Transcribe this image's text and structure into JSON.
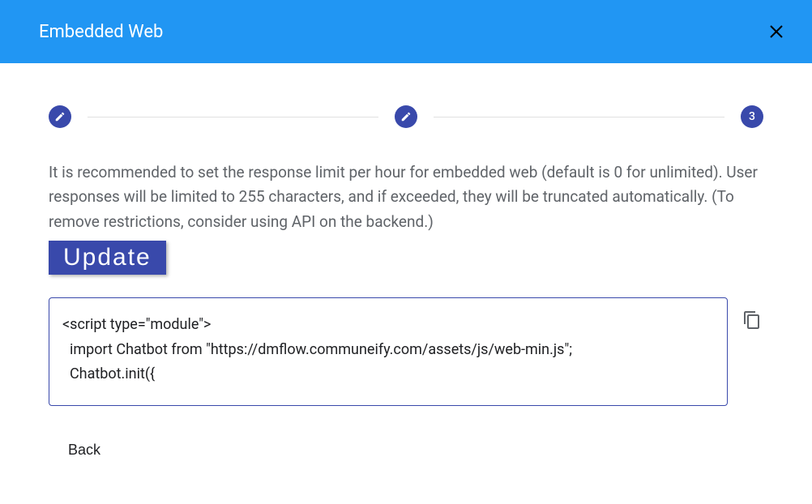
{
  "header": {
    "title": "Embedded Web"
  },
  "stepper": {
    "current_step": "3"
  },
  "description": "It is recommended to set the response limit per hour for embedded web (default is 0 for unlimited). User responses will be limited to 255 characters, and if exceeded, they will be truncated automatically. (To remove restrictions, consider using API on the backend.)",
  "buttons": {
    "update": "Update",
    "back": "Back"
  },
  "code": "<script type=\"module\">\n  import Chatbot from \"https://dmflow.communeify.com/assets/js/web-min.js\";\n  Chatbot.init({"
}
